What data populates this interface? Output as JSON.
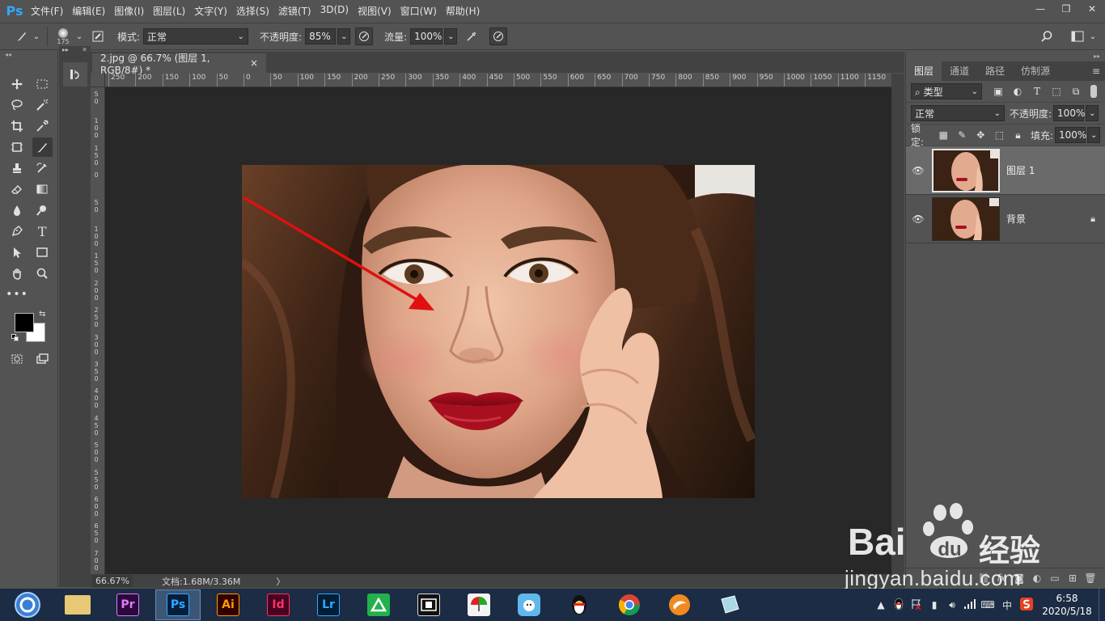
{
  "app": {
    "logo": "Ps",
    "menu": [
      "文件(F)",
      "编辑(E)",
      "图像(I)",
      "图层(L)",
      "文字(Y)",
      "选择(S)",
      "滤镜(T)",
      "3D(D)",
      "视图(V)",
      "窗口(W)",
      "帮助(H)"
    ],
    "window_controls": {
      "minimize": "—",
      "restore": "❐",
      "close": "✕"
    }
  },
  "options": {
    "brush_size": "175",
    "mode_label": "模式:",
    "mode_value": "正常",
    "opacity_label": "不透明度:",
    "opacity_value": "85%",
    "flow_label": "流量:",
    "flow_value": "100%"
  },
  "document": {
    "tab_title": "2.jpg @ 66.7% (图层 1, RGB/8#) *",
    "tab_close": "×",
    "ruler_h": [
      "250",
      "200",
      "150",
      "100",
      "50",
      "0",
      "50",
      "100",
      "150",
      "200",
      "250",
      "300",
      "350",
      "400",
      "450",
      "500",
      "550",
      "600",
      "650",
      "700",
      "750",
      "800",
      "850",
      "900",
      "950",
      "1000",
      "1050",
      "1100",
      "1150"
    ],
    "ruler_v": [
      "5 0",
      "1 0 0",
      "1 5 0",
      "0",
      "5 0",
      "1 0 0",
      "1 5 0",
      "2 0 0",
      "2 5 0",
      "3 0 0",
      "3 5 0",
      "4 0 0",
      "4 5 0",
      "5 0 0",
      "5 5 0",
      "6 0 0",
      "6 5 0",
      "7 0 0",
      "7 5 0",
      "8 0 0"
    ]
  },
  "status": {
    "zoom": "66.67%",
    "doc_info": "文档:1.68M/3.36M",
    "arrow": "〉"
  },
  "layers_panel": {
    "tabs": [
      "图层",
      "通道",
      "路径",
      "仿制源"
    ],
    "filter_kind": "类型",
    "blend_mode": "正常",
    "opacity_label": "不透明度:",
    "opacity_value": "100%",
    "lock_label": "锁定:",
    "fill_label": "填充:",
    "fill_value": "100%",
    "layers": [
      {
        "name": "图层 1",
        "selected": true,
        "locked": false
      },
      {
        "name": "背景",
        "selected": false,
        "locked": true
      }
    ]
  },
  "taskbar": {
    "apps": [
      {
        "name": "file-explorer",
        "label": "",
        "bg": "#e8c874",
        "fg": "#5a4a20"
      },
      {
        "name": "premiere",
        "label": "Pr",
        "bg": "#2a0a3a",
        "fg": "#e07bff"
      },
      {
        "name": "photoshop",
        "label": "Ps",
        "bg": "#061e3c",
        "fg": "#31a8ff"
      },
      {
        "name": "illustrator",
        "label": "Ai",
        "bg": "#330000",
        "fg": "#ff9a00"
      },
      {
        "name": "indesign",
        "label": "Id",
        "bg": "#49021f",
        "fg": "#ff3366"
      },
      {
        "name": "lightroom",
        "label": "Lr",
        "bg": "#001e36",
        "fg": "#31a8ff"
      }
    ],
    "clock_time": "6:58",
    "clock_date": "2020/5/18",
    "ime": "中"
  },
  "watermark": {
    "brand": "Bai",
    "brand2": "du",
    "cn": "经验",
    "url": "jingyan.baidu.com"
  },
  "colors": {
    "ui_bg": "#535353",
    "canvas_bg": "#282828",
    "accent": "#31a8ff",
    "arrow": "#e01010"
  }
}
